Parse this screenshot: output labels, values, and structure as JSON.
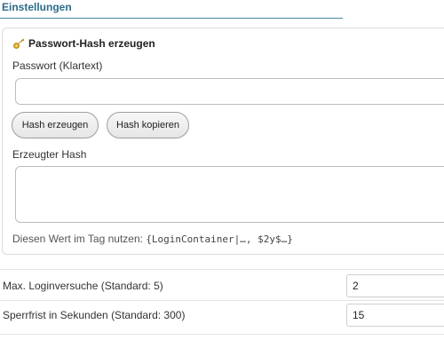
{
  "section": {
    "title": "Einstellungen"
  },
  "hash_card": {
    "title": "Passwort-Hash erzeugen",
    "icon": "key-icon",
    "password_label": "Passwort (Klartext)",
    "password_value": "",
    "generate_button": "Hash erzeugen",
    "copy_button": "Hash kopieren",
    "hash_label": "Erzeugter Hash",
    "hash_value": "",
    "hint_text": "Diesen Wert im Tag nutzen: ",
    "hint_code": "{LoginContainer|…, $2y$…}"
  },
  "settings": {
    "max_login_label": "Max. Loginversuche (Standard: 5)",
    "max_login_value": "2",
    "lock_label": "Sperrfrist in Sekunden (Standard: 300)",
    "lock_value": "15"
  },
  "colors": {
    "accent": "#2b6c8a",
    "rule": "#4a87a7"
  }
}
